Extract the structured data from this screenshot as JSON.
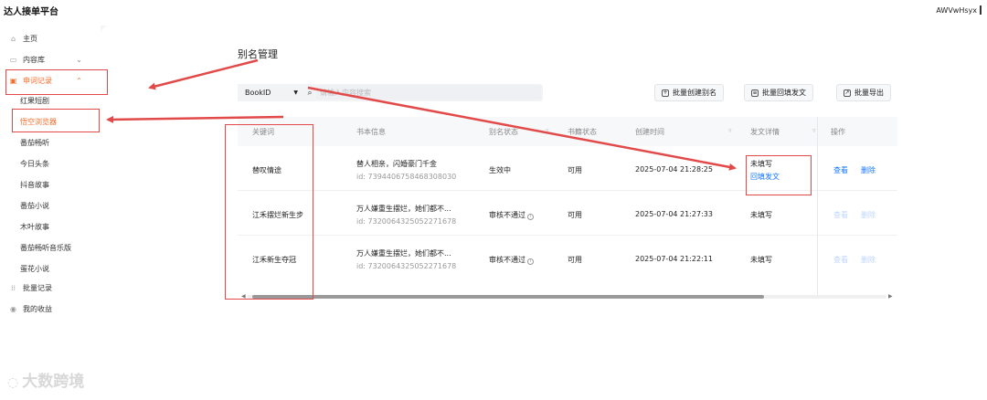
{
  "app": {
    "title": "达人接单平台",
    "user": "AWVwHsyx"
  },
  "sidebar": {
    "items": [
      {
        "label": "主页",
        "icon": "home-icon"
      },
      {
        "label": "内容库",
        "icon": "library-icon"
      },
      {
        "label": "申词记录",
        "icon": "record-icon"
      }
    ],
    "sub_items": [
      "红果短剧",
      "悟空浏览器",
      "番茄畅听",
      "今日头条",
      "抖音故事",
      "番茄小说",
      "木叶故事",
      "番茄畅听音乐版",
      "蛋花小说"
    ],
    "bottom_items": [
      {
        "label": "批量记录",
        "icon": "batch-icon"
      },
      {
        "label": "我的收益",
        "icon": "income-icon"
      }
    ]
  },
  "page": {
    "title": "别名管理",
    "filter_select": "BookID",
    "search_placeholder": "请输入内容搜索",
    "buttons": [
      "批量创建别名",
      "批量回填发文",
      "批量导出"
    ]
  },
  "table": {
    "headers": [
      "关键词",
      "书本信息",
      "别名状态",
      "书籍状态",
      "创建时间",
      "发文详情",
      "操作"
    ],
    "rows": [
      {
        "keyword": "替叹情途",
        "book_title": "替人相亲，闪婚豪门千金",
        "book_id": "id: 7394406758468308030",
        "alias_status": "生效中",
        "book_status": "可用",
        "created": "2025-07-04 21:28:25",
        "post_status": "未填写",
        "post_link": "回填发文",
        "action_view": "查看",
        "action_delete": "删除"
      },
      {
        "keyword": "江禾摆烂新生步",
        "book_title": "万人嫌重生摆烂，她们都不...",
        "book_id": "id: 7320064325052271678",
        "alias_status": "审核不通过",
        "book_status": "可用",
        "created": "2025-07-04 21:27:33",
        "post_status": "未填写",
        "post_link": "",
        "action_view": "查看",
        "action_delete": "删除"
      },
      {
        "keyword": "江禾新生夺冠",
        "book_title": "万人嫌重生摆烂，她们都不...",
        "book_id": "id: 7320064325052271678",
        "alias_status": "审核不通过",
        "book_status": "可用",
        "created": "2025-07-04 21:22:11",
        "post_status": "未填写",
        "post_link": "",
        "action_view": "查看",
        "action_delete": "删除"
      }
    ]
  },
  "watermark": "大数跨境",
  "colors": {
    "accent": "#f56c2a",
    "link": "#1677ff",
    "annotation": "#e24a4a"
  }
}
